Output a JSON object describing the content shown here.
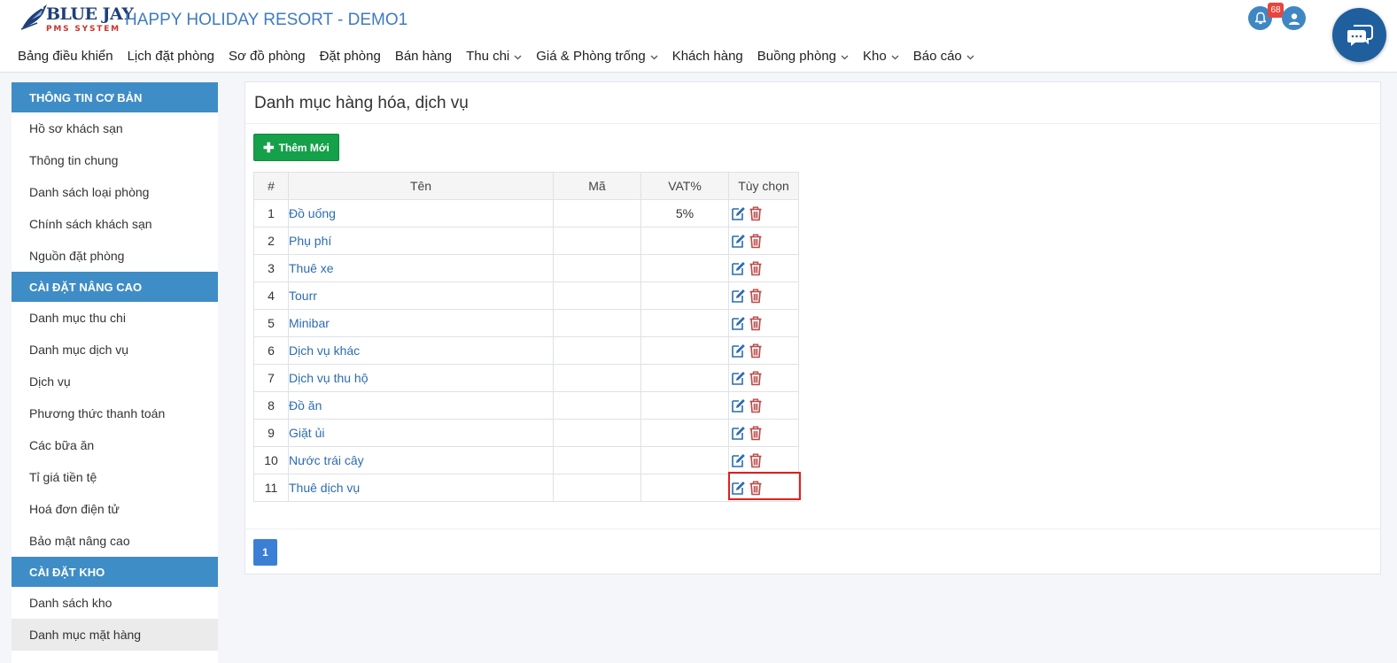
{
  "brand": {
    "logo_name": "BLUE JAY",
    "logo_sub": "PMS SYSTEM",
    "app_title": "HAPPY HOLIDAY RESORT - DEMO1"
  },
  "nav": {
    "items": [
      {
        "label": "Bảng điều khiển",
        "dropdown": false
      },
      {
        "label": "Lịch đặt phòng",
        "dropdown": false
      },
      {
        "label": "Sơ đồ phòng",
        "dropdown": false
      },
      {
        "label": "Đặt phòng",
        "dropdown": false
      },
      {
        "label": "Bán hàng",
        "dropdown": false
      },
      {
        "label": "Thu chi",
        "dropdown": true
      },
      {
        "label": "Giá & Phòng trống",
        "dropdown": true
      },
      {
        "label": "Khách hàng",
        "dropdown": false
      },
      {
        "label": "Buồng phòng",
        "dropdown": true
      },
      {
        "label": "Kho",
        "dropdown": true
      },
      {
        "label": "Báo cáo",
        "dropdown": true
      }
    ]
  },
  "header_right": {
    "notification_count": "68",
    "icons": [
      "bell-icon",
      "user-icon",
      "chat-icon"
    ]
  },
  "sidebar": {
    "sections": [
      {
        "title": "THÔNG TIN CƠ BẢN",
        "items": [
          "Hồ sơ khách sạn",
          "Thông tin chung",
          "Danh sách loại phòng",
          "Chính sách khách sạn",
          "Nguồn đặt phòng"
        ]
      },
      {
        "title": "CÀI ĐẶT NÂNG CAO",
        "items": [
          "Danh mục thu chi",
          "Danh mục dịch vụ",
          "Dịch vụ",
          "Phương thức thanh toán",
          "Các bữa ăn",
          "Tỉ giá tiền tệ",
          "Hoá đơn điện tử",
          "Bảo mật nâng cao"
        ]
      },
      {
        "title": "CÀI ĐẶT KHO",
        "items": [
          "Danh sách kho",
          "Danh mục mặt hàng"
        ]
      }
    ],
    "active_item": "Danh mục mặt hàng"
  },
  "main": {
    "title": "Danh mục hàng hóa, dịch vụ",
    "add_button_label": "Thêm Mới",
    "table": {
      "headers": [
        "#",
        "Tên",
        "Mã",
        "VAT%",
        "Tùy chọn"
      ],
      "rows": [
        {
          "num": "1",
          "name": "Đồ uống",
          "code": "",
          "vat": "5%"
        },
        {
          "num": "2",
          "name": "Phụ phí",
          "code": "",
          "vat": ""
        },
        {
          "num": "3",
          "name": "Thuê xe",
          "code": "",
          "vat": ""
        },
        {
          "num": "4",
          "name": "Tourr",
          "code": "",
          "vat": ""
        },
        {
          "num": "5",
          "name": "Minibar",
          "code": "",
          "vat": ""
        },
        {
          "num": "6",
          "name": "Dịch vụ khác",
          "code": "",
          "vat": ""
        },
        {
          "num": "7",
          "name": "Dịch vụ thu hộ",
          "code": "",
          "vat": ""
        },
        {
          "num": "8",
          "name": "Đồ ăn",
          "code": "",
          "vat": ""
        },
        {
          "num": "9",
          "name": "Giặt ủi",
          "code": "",
          "vat": ""
        },
        {
          "num": "10",
          "name": "Nước trái cây",
          "code": "",
          "vat": ""
        },
        {
          "num": "11",
          "name": "Thuê dịch vụ",
          "code": "",
          "vat": ""
        }
      ]
    },
    "pagination": {
      "current_page": "1"
    }
  },
  "colors": {
    "brand_blue": "#3e7bc0",
    "section_header": "#3f8dc6",
    "add_button": "#15a04a",
    "link": "#2c6cb0",
    "edit_icon": "#2c6cb0",
    "delete_icon": "#b94a48",
    "highlight": "#e02020"
  }
}
